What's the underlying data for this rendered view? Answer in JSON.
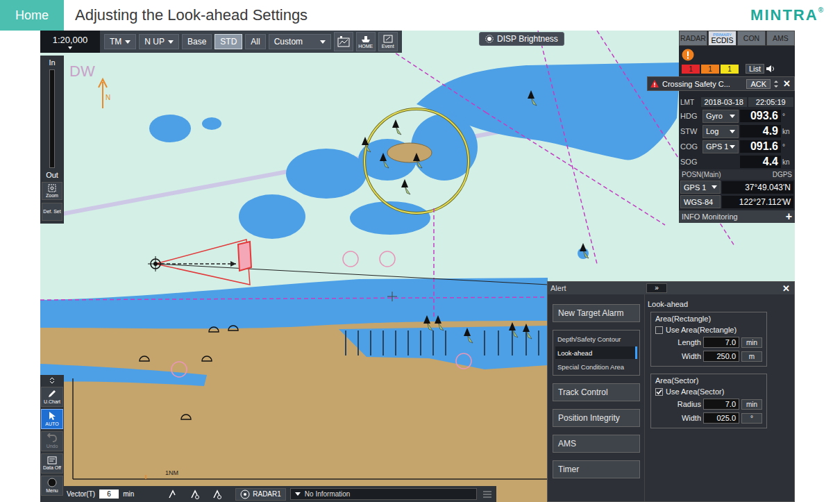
{
  "header": {
    "home": "Home",
    "title": "Adjusting the Look-ahead Settings",
    "logo": "MINTRA",
    "logo_mark": "®"
  },
  "toolbar": {
    "scale": "1:20,000",
    "items": [
      {
        "label": "TM",
        "dropdown": true,
        "selected": false
      },
      {
        "label": "N UP",
        "dropdown": true,
        "selected": false
      },
      {
        "label": "Base",
        "dropdown": false,
        "selected": false
      },
      {
        "label": "STD",
        "dropdown": false,
        "selected": true
      },
      {
        "label": "All",
        "dropdown": false,
        "selected": false
      },
      {
        "label": "Custom",
        "dropdown": true,
        "selected": false
      }
    ],
    "icon_buttons": [
      {
        "kind": "chart"
      },
      {
        "kind": "home",
        "label": "HOME"
      },
      {
        "kind": "event",
        "label": "Event"
      }
    ]
  },
  "brightness": "DISP Brightness",
  "zoom": {
    "in": "In",
    "out": "Out",
    "zoom": "Zoom",
    "default_set": "Def. Set"
  },
  "left_tools": [
    {
      "kind": "pencil",
      "label": "U.Chart",
      "selected": false,
      "disabled": false
    },
    {
      "kind": "cursor",
      "label": "AUTO",
      "selected": true,
      "disabled": false
    },
    {
      "kind": "undo",
      "label": "Undo",
      "selected": false,
      "disabled": true
    },
    {
      "kind": "data",
      "label": "Data Off",
      "selected": false,
      "disabled": false
    },
    {
      "kind": "menu",
      "label": "Menu",
      "selected": false,
      "disabled": false
    }
  ],
  "bottom_bar": {
    "vector_label": "Vector(T)",
    "vector_value": "6",
    "vector_unit": "min",
    "radar": "RADAR1",
    "info": "No Information"
  },
  "side_panel": {
    "tabs": [
      {
        "label": "RADAR",
        "selected": false
      },
      {
        "label": "ECDIS",
        "selected": true,
        "badge": "PRIMARY"
      },
      {
        "label": "CON",
        "selected": false
      },
      {
        "label": "AMS",
        "selected": false
      }
    ],
    "alert_counts": [
      {
        "count": "1",
        "color": "#e3262b"
      },
      {
        "count": "1",
        "color": "#f0801e"
      },
      {
        "count": "1",
        "color": "#f2e21c"
      }
    ],
    "alert_list": "List",
    "alert_popup": {
      "text": "Crossing Safety C...",
      "ack": "ACK",
      "close": "✕"
    },
    "time": {
      "label": "LMT",
      "date": "2018-03-18",
      "clock": "22:05:19"
    },
    "sensors": [
      {
        "name": "HDG",
        "source": "Gyro",
        "value": "093.6",
        "unit": "°"
      },
      {
        "name": "STW",
        "source": "Log",
        "value": "4.9",
        "unit": "kn"
      },
      {
        "name": "COG",
        "source": "GPS 1",
        "value": "091.6",
        "unit": "°"
      },
      {
        "name": "SOG",
        "value": "4.4",
        "unit": "kn"
      }
    ],
    "position": {
      "label": "POSN(Main)",
      "quality": "DGPS",
      "source": "GPS 1",
      "lat": "37°49.043'N",
      "datum": "WGS-84",
      "lon": "122°27.112'W"
    },
    "info": "INFO Monitoring",
    "info_expand": "+"
  },
  "alert_dialog": {
    "title": "Alert",
    "collapse": "»",
    "close": "✕",
    "menu": [
      {
        "label": "New Target Alarm",
        "kind": "large",
        "selected": false
      },
      {
        "label": "Depth/Safety Contour",
        "kind": "small",
        "selected": false
      },
      {
        "label": "Look-ahead",
        "kind": "small",
        "selected": true
      },
      {
        "label": "Special Condition Area",
        "kind": "small",
        "selected": false
      },
      {
        "label": "Track Control",
        "kind": "large",
        "selected": false
      },
      {
        "label": "Position Integrity",
        "kind": "large",
        "selected": false
      },
      {
        "label": "AMS",
        "kind": "large",
        "selected": false
      },
      {
        "label": "Timer",
        "kind": "large",
        "selected": false
      }
    ],
    "section_title": "Look-ahead",
    "groups": [
      {
        "title": "Area(Rectangle)",
        "check_label": "Use Area(Rectangle)",
        "checked": false,
        "fields": [
          {
            "label": "Length",
            "value": "7.0",
            "unit": "min"
          },
          {
            "label": "Width",
            "value": "250.0",
            "unit": "m"
          }
        ]
      },
      {
        "title": "Area(Sector)",
        "check_label": "Use Area(Sector)",
        "checked": true,
        "fields": [
          {
            "label": "Radius",
            "value": "7.0",
            "unit": "min"
          },
          {
            "label": "Width",
            "value": "025.0",
            "unit": "°"
          }
        ]
      }
    ]
  },
  "map": {
    "north": "N",
    "scale_label": "1NM",
    "area_label": "DW"
  }
}
